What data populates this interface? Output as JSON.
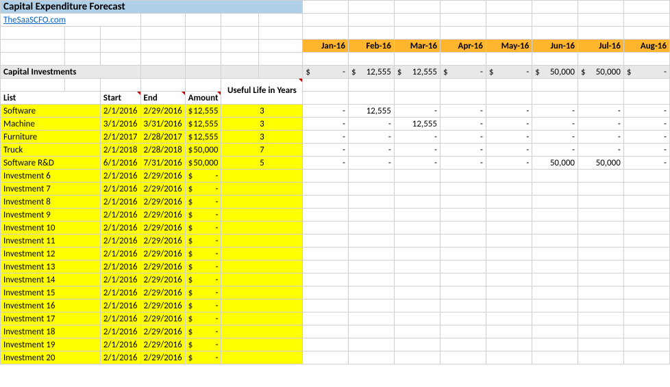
{
  "header": {
    "title": "Capital Expenditure Forecast",
    "link": "TheSaaSCFO.com"
  },
  "months": [
    "Jan-16",
    "Feb-16",
    "Mar-16",
    "Apr-16",
    "May-16",
    "Jun-16",
    "Jul-16",
    "Aug-16"
  ],
  "section_label": "Capital Investments",
  "totals": [
    "-",
    "12,555",
    "12,555",
    "-",
    "-",
    "50,000",
    "50,000",
    "-"
  ],
  "columns": {
    "list": "List",
    "start": "Start",
    "end": "End",
    "amount": "Amount",
    "useful_life": "Useful Life in Years"
  },
  "rows": [
    {
      "name": "Software",
      "start": "2/1/2016",
      "end": "2/29/2016",
      "amount": "12,555",
      "life": "3",
      "m": [
        "-",
        "12,555",
        "-",
        "-",
        "-",
        "-",
        "-",
        "-"
      ]
    },
    {
      "name": "Machine",
      "start": "3/1/2016",
      "end": "3/31/2016",
      "amount": "12,555",
      "life": "3",
      "m": [
        "-",
        "-",
        "12,555",
        "-",
        "-",
        "-",
        "-",
        "-"
      ]
    },
    {
      "name": "Furniture",
      "start": "2/1/2017",
      "end": "2/28/2017",
      "amount": "12,555",
      "life": "3",
      "m": [
        "-",
        "-",
        "-",
        "-",
        "-",
        "-",
        "-",
        "-"
      ]
    },
    {
      "name": "Truck",
      "start": "2/1/2018",
      "end": "2/28/2018",
      "amount": "50,000",
      "life": "7",
      "m": [
        "-",
        "-",
        "-",
        "-",
        "-",
        "-",
        "-",
        "-"
      ]
    },
    {
      "name": "Software R&D",
      "start": "6/1/2016",
      "end": "7/31/2016",
      "amount": "50,000",
      "life": "5",
      "m": [
        "-",
        "-",
        "-",
        "-",
        "-",
        "50,000",
        "50,000",
        "-"
      ]
    },
    {
      "name": "Investment 6",
      "start": "2/1/2016",
      "end": "2/29/2016",
      "amount": "-",
      "life": "",
      "m": [
        "",
        "",
        "",
        "",
        "",
        "",
        "",
        ""
      ]
    },
    {
      "name": "Investment 7",
      "start": "2/1/2016",
      "end": "2/29/2016",
      "amount": "-",
      "life": "",
      "m": [
        "",
        "",
        "",
        "",
        "",
        "",
        "",
        ""
      ]
    },
    {
      "name": "Investment 8",
      "start": "2/1/2016",
      "end": "2/29/2016",
      "amount": "-",
      "life": "",
      "m": [
        "",
        "",
        "",
        "",
        "",
        "",
        "",
        ""
      ]
    },
    {
      "name": "Investment 9",
      "start": "2/1/2016",
      "end": "2/29/2016",
      "amount": "-",
      "life": "",
      "m": [
        "",
        "",
        "",
        "",
        "",
        "",
        "",
        ""
      ]
    },
    {
      "name": "Investment 10",
      "start": "2/1/2016",
      "end": "2/29/2016",
      "amount": "-",
      "life": "",
      "m": [
        "",
        "",
        "",
        "",
        "",
        "",
        "",
        ""
      ]
    },
    {
      "name": "Investment 11",
      "start": "2/1/2016",
      "end": "2/29/2016",
      "amount": "-",
      "life": "",
      "m": [
        "",
        "",
        "",
        "",
        "",
        "",
        "",
        ""
      ]
    },
    {
      "name": "Investment 12",
      "start": "2/1/2016",
      "end": "2/29/2016",
      "amount": "-",
      "life": "",
      "m": [
        "",
        "",
        "",
        "",
        "",
        "",
        "",
        ""
      ]
    },
    {
      "name": "Investment 13",
      "start": "2/1/2016",
      "end": "2/29/2016",
      "amount": "-",
      "life": "",
      "m": [
        "",
        "",
        "",
        "",
        "",
        "",
        "",
        ""
      ]
    },
    {
      "name": "Investment 14",
      "start": "2/1/2016",
      "end": "2/29/2016",
      "amount": "-",
      "life": "",
      "m": [
        "",
        "",
        "",
        "",
        "",
        "",
        "",
        ""
      ]
    },
    {
      "name": "Investment 15",
      "start": "2/1/2016",
      "end": "2/29/2016",
      "amount": "-",
      "life": "",
      "m": [
        "",
        "",
        "",
        "",
        "",
        "",
        "",
        ""
      ]
    },
    {
      "name": "Investment 16",
      "start": "2/1/2016",
      "end": "2/29/2016",
      "amount": "-",
      "life": "",
      "m": [
        "",
        "",
        "",
        "",
        "",
        "",
        "",
        ""
      ]
    },
    {
      "name": "Investment 17",
      "start": "2/1/2016",
      "end": "2/29/2016",
      "amount": "-",
      "life": "",
      "m": [
        "",
        "",
        "",
        "",
        "",
        "",
        "",
        ""
      ]
    },
    {
      "name": "Investment 18",
      "start": "2/1/2016",
      "end": "2/29/2016",
      "amount": "-",
      "life": "",
      "m": [
        "",
        "",
        "",
        "",
        "",
        "",
        "",
        ""
      ]
    },
    {
      "name": "Investment 19",
      "start": "2/1/2016",
      "end": "2/29/2016",
      "amount": "-",
      "life": "",
      "m": [
        "",
        "",
        "",
        "",
        "",
        "",
        "",
        ""
      ]
    },
    {
      "name": "Investment 20",
      "start": "2/1/2016",
      "end": "2/29/2016",
      "amount": "-",
      "life": "",
      "m": [
        "",
        "",
        "",
        "",
        "",
        "",
        "",
        ""
      ]
    }
  ]
}
